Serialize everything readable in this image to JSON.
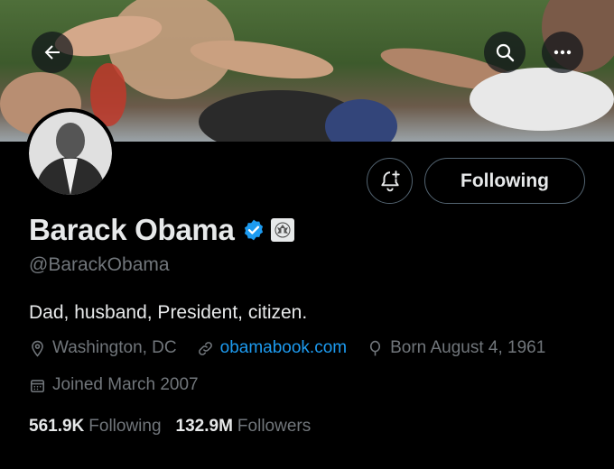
{
  "profile": {
    "name": "Barack Obama",
    "handle": "@BarackObama",
    "bio": "Dad, husband, President, citizen.",
    "location": "Washington, DC",
    "website": "obamabook.com",
    "birthday": "Born August 4, 1961",
    "joined": "Joined March 2007",
    "following_count": "561.9K",
    "following_label": "Following",
    "followers_count": "132.9M",
    "followers_label": "Followers"
  },
  "actions": {
    "follow_button_label": "Following"
  },
  "icons": {
    "back": "arrow-left-icon",
    "search": "search-icon",
    "more": "more-icon",
    "notify": "bell-plus-icon",
    "verified": "verified-check-icon",
    "government": "government-seal-icon",
    "location": "location-pin-icon",
    "link": "link-icon",
    "birthday": "balloon-icon",
    "calendar": "calendar-icon"
  },
  "colors": {
    "background": "#000000",
    "primary_text": "#e7e9ea",
    "secondary_text": "#71767b",
    "link": "#1d9bf0",
    "verified": "#1d9bf0",
    "border": "#536471"
  }
}
